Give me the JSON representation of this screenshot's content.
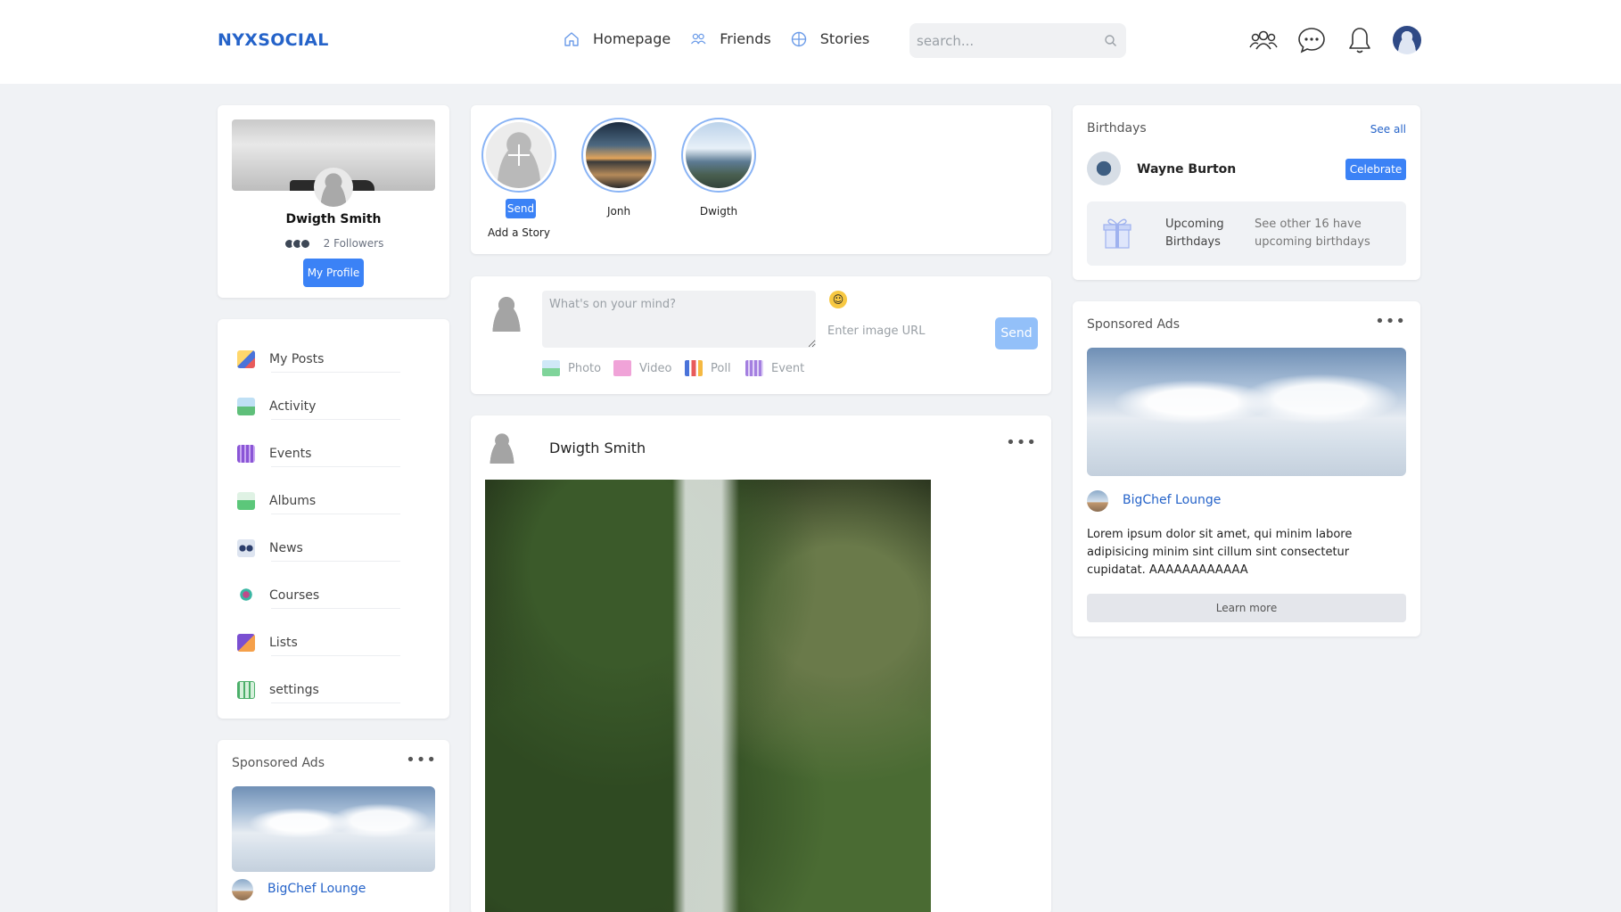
{
  "brand": {
    "logo": "NYXSOCIAL"
  },
  "nav": {
    "items": [
      {
        "label": "Homepage",
        "icon": "home-icon"
      },
      {
        "label": "Friends",
        "icon": "friends-icon"
      },
      {
        "label": "Stories",
        "icon": "globe-icon"
      }
    ],
    "search_placeholder": "search..."
  },
  "top_icons": [
    "users-icon",
    "chat-icon",
    "bell-icon",
    "user-avatar"
  ],
  "colors": {
    "accent": "#3b82f6",
    "link": "#2563c9",
    "background": "#f0f2f5"
  },
  "profile": {
    "name": "Dwigth Smith",
    "followers": "2 Followers",
    "button": "My Profile"
  },
  "menu": {
    "items": [
      {
        "label": "My Posts",
        "icon": "posts-icon"
      },
      {
        "label": "Activity",
        "icon": "activity-icon"
      },
      {
        "label": "Events",
        "icon": "calendar-icon"
      },
      {
        "label": "Albums",
        "icon": "album-icon"
      },
      {
        "label": "News",
        "icon": "news-icon"
      },
      {
        "label": "Courses",
        "icon": "courses-icon"
      },
      {
        "label": "Lists",
        "icon": "lists-icon"
      },
      {
        "label": "settings",
        "icon": "settings-icon"
      }
    ]
  },
  "sponsored_left": {
    "title": "Sponsored Ads",
    "business": "BigChef Lounge"
  },
  "stories": {
    "add": {
      "send_label": "Send",
      "label": "Add a Story"
    },
    "items": [
      {
        "label": "Jonh"
      },
      {
        "label": "Dwigth"
      }
    ]
  },
  "composer": {
    "placeholder": "What's on your mind?",
    "url_placeholder": "Enter image URL",
    "send_label": "Send",
    "attachments": [
      {
        "label": "Photo",
        "icon": "photo-icon"
      },
      {
        "label": "Video",
        "icon": "video-icon"
      },
      {
        "label": "Poll",
        "icon": "poll-icon"
      },
      {
        "label": "Event",
        "icon": "event-icon"
      }
    ]
  },
  "post": {
    "author": "Dwigth Smith",
    "image": "waterfall-photo"
  },
  "birthdays": {
    "title": "Birthdays",
    "see_all": "See all",
    "person": "Wayne Burton",
    "celebrate": "Celebrate",
    "upcoming_label": "Upcoming Birthdays",
    "upcoming_text": "See other 16 have upcoming birthdays"
  },
  "sponsored_right": {
    "title": "Sponsored Ads",
    "business": "BigChef Lounge",
    "text": "Lorem ipsum dolor sit amet, qui minim labore adipisicing minim sint cillum sint consectetur cupidatat. AAAAAAAAAAAA",
    "button": "Learn more"
  }
}
